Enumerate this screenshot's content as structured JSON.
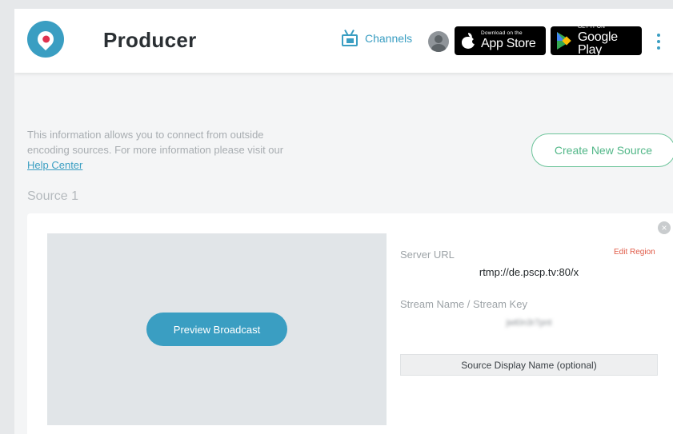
{
  "header": {
    "title": "Producer",
    "channels_label": "Channels",
    "app_store": {
      "small": "Download on the",
      "big": "App Store"
    },
    "google_play": {
      "small": "GET IT ON",
      "big": "Google Play"
    }
  },
  "info": {
    "text": "This information allows you to connect from outside encoding sources. For more information please visit our ",
    "link": "Help Center"
  },
  "create_button": "Create New Source",
  "source": {
    "title": "Source 1",
    "preview_button": "Preview Broadcast",
    "server_url_label": "Server URL",
    "edit_region": "Edit Region",
    "server_url_value": "rtmp://de.pscp.tv:80/x",
    "stream_key_label": "Stream Name / Stream Key",
    "stream_key_value": "jwt0n3r7pnt",
    "display_name_placeholder": "Source Display Name (optional)"
  },
  "colors": {
    "accent": "#3a9ec2",
    "create_green": "#52b788",
    "edit_region": "#e05a47"
  },
  "icons": [
    "periscope-logo-icon",
    "tv-icon",
    "avatar",
    "apple-icon",
    "google-play-icon",
    "kebab-menu-icon",
    "close-icon"
  ]
}
